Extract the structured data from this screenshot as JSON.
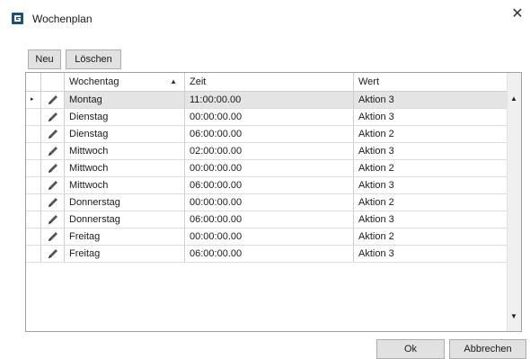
{
  "window": {
    "title": "Wochenplan",
    "close_glyph": "✕",
    "logo_icon": "app-logo-icon"
  },
  "toolbar": {
    "new_label": "Neu",
    "delete_label": "Löschen"
  },
  "grid": {
    "columns": [
      "Wochentag",
      "Zeit",
      "Wert"
    ],
    "sort_glyph": "▲",
    "row_indicator_glyph": "▸",
    "rows": [
      {
        "day": "Montag",
        "time": "11:00:00.00",
        "value": "Aktion 3"
      },
      {
        "day": "Dienstag",
        "time": "00:00:00.00",
        "value": "Aktion 3"
      },
      {
        "day": "Dienstag",
        "time": "06:00:00.00",
        "value": "Aktion 2"
      },
      {
        "day": "Mittwoch",
        "time": "02:00:00.00",
        "value": "Aktion 3"
      },
      {
        "day": "Mittwoch",
        "time": "00:00:00.00",
        "value": "Aktion 2"
      },
      {
        "day": "Mittwoch",
        "time": "06:00:00.00",
        "value": "Aktion 3"
      },
      {
        "day": "Donnerstag",
        "time": "00:00:00.00",
        "value": "Aktion 2"
      },
      {
        "day": "Donnerstag",
        "time": "06:00:00.00",
        "value": "Aktion 3"
      },
      {
        "day": "Freitag",
        "time": "00:00:00.00",
        "value": "Aktion 2"
      },
      {
        "day": "Freitag",
        "time": "06:00:00.00",
        "value": "Aktion 3"
      }
    ],
    "scroll_up_glyph": "▲",
    "scroll_down_glyph": "▼"
  },
  "footer": {
    "ok_label": "Ok",
    "cancel_label": "Abbrechen"
  },
  "colors": {
    "selected_row": "#e4e4e4",
    "button_bg": "#e1e1e1",
    "logo": "#1f4e79"
  }
}
